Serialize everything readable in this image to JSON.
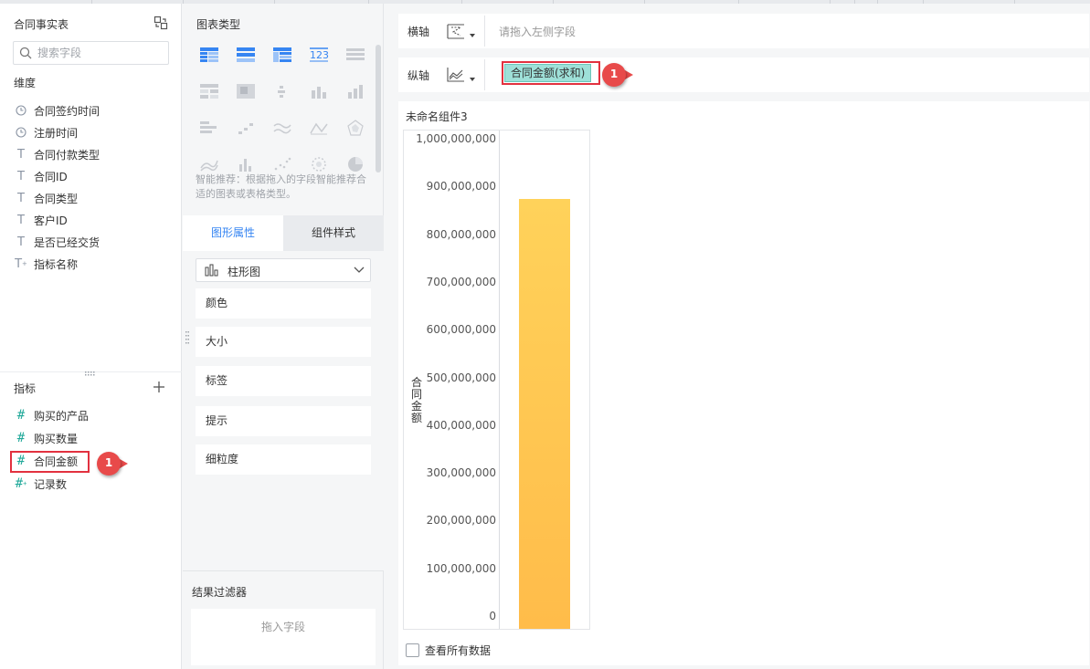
{
  "left_panel": {
    "title": "合同事实表",
    "search_placeholder": "搜索字段",
    "dimensions_label": "维度",
    "dimensions": [
      {
        "label": "合同签约时间",
        "icon": "clock-icon"
      },
      {
        "label": "注册时间",
        "icon": "clock-icon"
      },
      {
        "label": "合同付款类型",
        "icon": "text-icon"
      },
      {
        "label": "合同ID",
        "icon": "text-icon"
      },
      {
        "label": "合同类型",
        "icon": "text-icon"
      },
      {
        "label": "客户ID",
        "icon": "text-icon"
      },
      {
        "label": "是否已经交货",
        "icon": "text-icon"
      },
      {
        "label": "指标名称",
        "icon": "text-calc-icon"
      }
    ],
    "measures_label": "指标",
    "measures": [
      {
        "label": "购买的产品",
        "icon": "hash-icon"
      },
      {
        "label": "购买数量",
        "icon": "hash-icon"
      },
      {
        "label": "合同金额",
        "icon": "hash-icon"
      },
      {
        "label": "记录数",
        "icon": "hash-calc-icon"
      }
    ],
    "callout_number": "1"
  },
  "middle_panel": {
    "chart_types_title": "图表类型",
    "smart_hint": "智能推荐：根据拖入的字段智能推荐合适的图表或表格类型。",
    "tab_graph": "图形属性",
    "tab_style": "组件样式",
    "chart_type_value": "柱形图",
    "properties": [
      "颜色",
      "大小",
      "标签",
      "提示",
      "细粒度"
    ],
    "filter_title": "结果过滤器",
    "filter_drop_text": "拖入字段"
  },
  "axes": {
    "x_label": "横轴",
    "x_placeholder": "请拖入左侧字段",
    "y_label": "纵轴",
    "y_field": "合同金额(求和)",
    "callout_number": "1"
  },
  "component": {
    "title": "未命名组件3",
    "see_all": "查看所有数据"
  },
  "colors": {
    "accent": "#3685f2",
    "measure": "#22a99a",
    "highlight": "#e2313f",
    "bar_top": "#ffd25a",
    "bar_bottom": "#ffbc4a",
    "pill": "#9ee0d8"
  },
  "chart_data": {
    "type": "bar",
    "categories": [
      ""
    ],
    "values": [
      875000000
    ],
    "ylabel": "合同金额",
    "ylim": [
      0,
      1000000000
    ],
    "yticks": [
      "0",
      "100,000,000",
      "200,000,000",
      "300,000,000",
      "400,000,000",
      "500,000,000",
      "600,000,000",
      "700,000,000",
      "800,000,000",
      "900,000,000",
      "1,000,000,000"
    ],
    "grid": false,
    "legend": "none"
  }
}
